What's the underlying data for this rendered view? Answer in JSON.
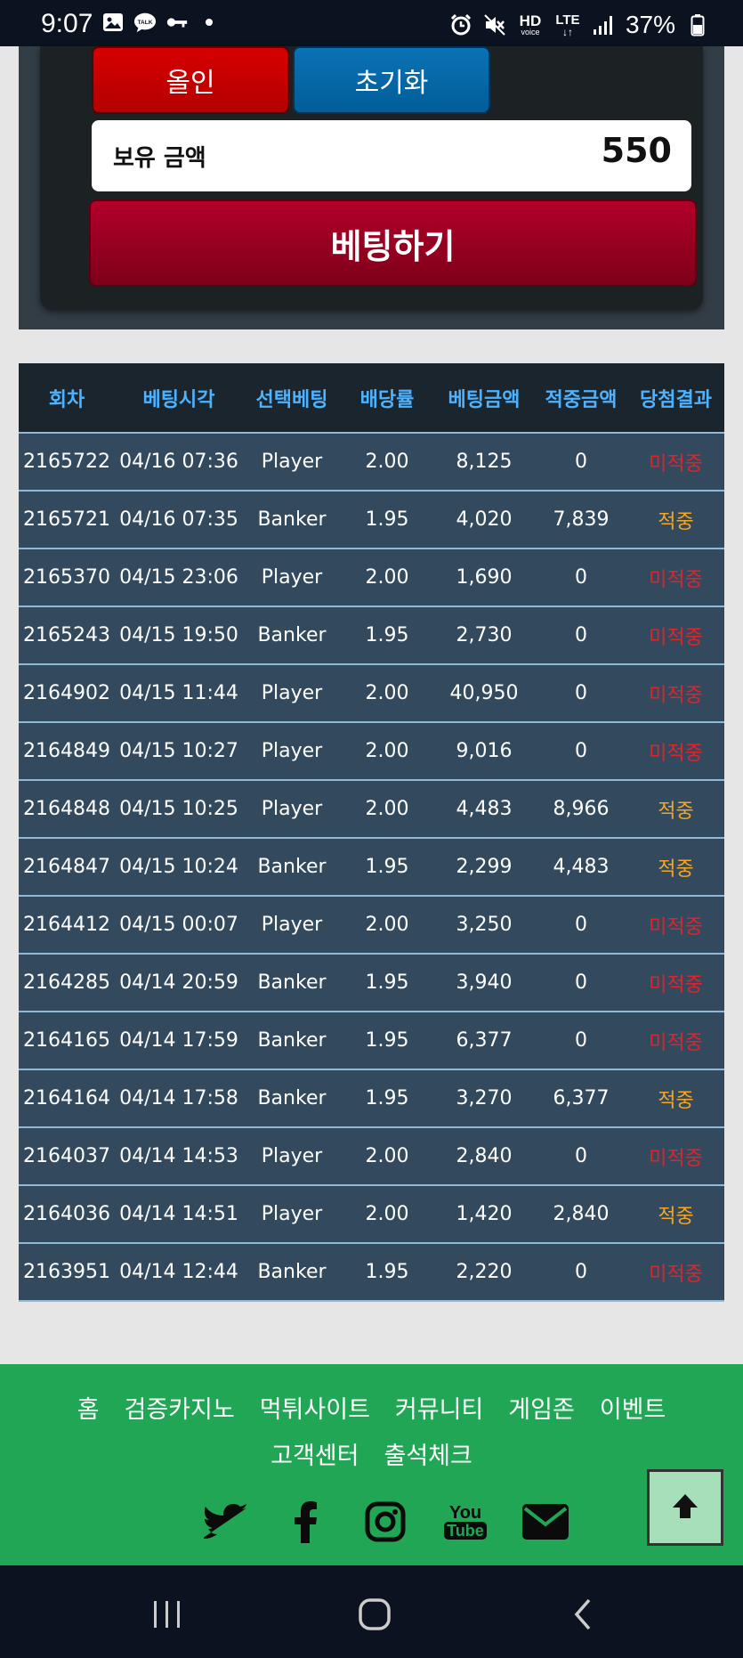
{
  "status_bar": {
    "time": "9:07",
    "battery": "37%",
    "left_icons": [
      "image-icon",
      "talk-icon",
      "key-icon",
      "dot-icon"
    ],
    "right_icons": [
      "alarm-icon",
      "mute-icon",
      "hd-voice-icon",
      "lte-icon",
      "signal-icon",
      "battery-icon"
    ],
    "hd_label": "HD",
    "hd_sub": "voice",
    "lte_label": "LTE"
  },
  "bet_panel": {
    "allin_label": "올인",
    "reset_label": "초기화",
    "balance_label": "보유 금액",
    "balance_value": "550",
    "bet_button_label": "베팅하기"
  },
  "history_table": {
    "headers": [
      "회차",
      "베팅시각",
      "선택베팅",
      "배당률",
      "베팅금액",
      "적중금액",
      "당첨결과"
    ],
    "rows": [
      {
        "round": "2165722",
        "time": "04/16 07:36",
        "choice": "Player",
        "odds": "2.00",
        "bet": "8,125",
        "win": "0",
        "result": "미적중",
        "hit": false
      },
      {
        "round": "2165721",
        "time": "04/16 07:35",
        "choice": "Banker",
        "odds": "1.95",
        "bet": "4,020",
        "win": "7,839",
        "result": "적중",
        "hit": true
      },
      {
        "round": "2165370",
        "time": "04/15 23:06",
        "choice": "Player",
        "odds": "2.00",
        "bet": "1,690",
        "win": "0",
        "result": "미적중",
        "hit": false
      },
      {
        "round": "2165243",
        "time": "04/15 19:50",
        "choice": "Banker",
        "odds": "1.95",
        "bet": "2,730",
        "win": "0",
        "result": "미적중",
        "hit": false
      },
      {
        "round": "2164902",
        "time": "04/15 11:44",
        "choice": "Player",
        "odds": "2.00",
        "bet": "40,950",
        "win": "0",
        "result": "미적중",
        "hit": false
      },
      {
        "round": "2164849",
        "time": "04/15 10:27",
        "choice": "Player",
        "odds": "2.00",
        "bet": "9,016",
        "win": "0",
        "result": "미적중",
        "hit": false
      },
      {
        "round": "2164848",
        "time": "04/15 10:25",
        "choice": "Player",
        "odds": "2.00",
        "bet": "4,483",
        "win": "8,966",
        "result": "적중",
        "hit": true
      },
      {
        "round": "2164847",
        "time": "04/15 10:24",
        "choice": "Banker",
        "odds": "1.95",
        "bet": "2,299",
        "win": "4,483",
        "result": "적중",
        "hit": true
      },
      {
        "round": "2164412",
        "time": "04/15 00:07",
        "choice": "Player",
        "odds": "2.00",
        "bet": "3,250",
        "win": "0",
        "result": "미적중",
        "hit": false
      },
      {
        "round": "2164285",
        "time": "04/14 20:59",
        "choice": "Banker",
        "odds": "1.95",
        "bet": "3,940",
        "win": "0",
        "result": "미적중",
        "hit": false
      },
      {
        "round": "2164165",
        "time": "04/14 17:59",
        "choice": "Banker",
        "odds": "1.95",
        "bet": "6,377",
        "win": "0",
        "result": "미적중",
        "hit": false
      },
      {
        "round": "2164164",
        "time": "04/14 17:58",
        "choice": "Banker",
        "odds": "1.95",
        "bet": "3,270",
        "win": "6,377",
        "result": "적중",
        "hit": true
      },
      {
        "round": "2164037",
        "time": "04/14 14:53",
        "choice": "Player",
        "odds": "2.00",
        "bet": "2,840",
        "win": "0",
        "result": "미적중",
        "hit": false
      },
      {
        "round": "2164036",
        "time": "04/14 14:51",
        "choice": "Player",
        "odds": "2.00",
        "bet": "1,420",
        "win": "2,840",
        "result": "적중",
        "hit": true
      },
      {
        "round": "2163951",
        "time": "04/14 12:44",
        "choice": "Banker",
        "odds": "1.95",
        "bet": "2,220",
        "win": "0",
        "result": "미적중",
        "hit": false
      }
    ]
  },
  "footer": {
    "links": [
      "홈",
      "검증카지노",
      "먹튀사이트",
      "커뮤니티",
      "게임존",
      "이벤트",
      "고객센터",
      "출석체크"
    ],
    "social_icons": [
      "twitter-icon",
      "facebook-icon",
      "instagram-icon",
      "youtube-icon",
      "mail-icon"
    ],
    "youtube_label_top": "You",
    "youtube_label_bottom": "Tube",
    "back_to_top_icon": "arrow-up-icon"
  },
  "colors": {
    "footer_bg": "#21a656",
    "miss": "#e2232a",
    "hit": "#f5a623",
    "header_text": "#4db2ff",
    "row_bg": "#334a5e"
  }
}
